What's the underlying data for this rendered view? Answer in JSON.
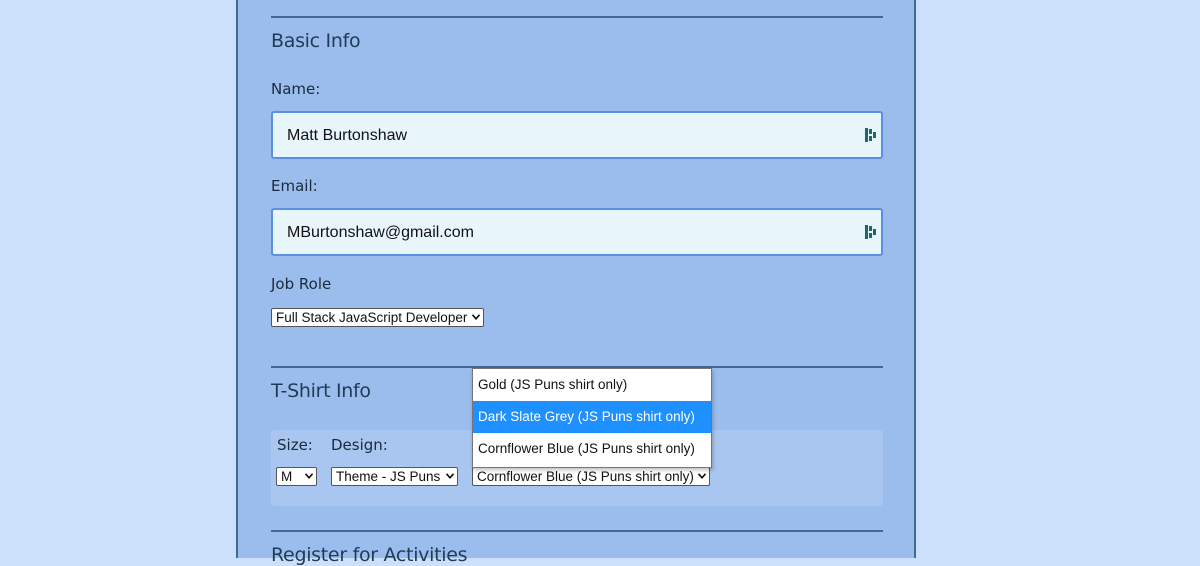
{
  "basic_info": {
    "title": "Basic Info",
    "name_label": "Name:",
    "name_value": "Matt Burtonshaw",
    "email_label": "Email:",
    "email_value": "MBurtonshaw@gmail.com",
    "job_role_label": "Job Role",
    "job_role_value": "Full Stack JavaScript Developer"
  },
  "tshirt_info": {
    "title": "T-Shirt Info",
    "size_label": "Size:",
    "size_value": "M",
    "design_label": "Design:",
    "design_value": "Theme - JS Puns",
    "color_value": "Cornflower Blue (JS Puns shirt only)",
    "color_options": [
      "Gold (JS Puns shirt only)",
      "Dark Slate Grey (JS Puns shirt only)",
      "Cornflower Blue (JS Puns shirt only)"
    ],
    "highlighted_option": "Dark Slate Grey (JS Puns shirt only)"
  },
  "activities": {
    "title": "Register for Activities"
  },
  "colors": {
    "page_bg": "#cce0fb",
    "panel_bg": "#9bbdee",
    "input_bg": "#e8f5fb",
    "input_border": "#5b8fe0",
    "highlight": "#1e90ff"
  },
  "icons": {
    "input_side_icon": "password-manager-icon",
    "select_arrow": "chevron-down-icon"
  }
}
